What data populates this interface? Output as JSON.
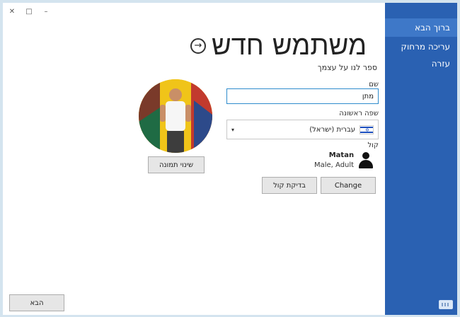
{
  "window_controls": {
    "close": "✕",
    "restore": "□",
    "minimize": "–"
  },
  "sidebar": {
    "items": [
      {
        "label": "ברוך הבא",
        "active": true
      },
      {
        "label": "עריכה מרחוק",
        "active": false
      },
      {
        "label": "עזרה",
        "active": false
      }
    ]
  },
  "header": {
    "title": "משתמש חדש",
    "subtitle": "ספר לנו על עצמך",
    "back_icon": "→"
  },
  "form": {
    "name_label": "שם",
    "name_value": "מתן",
    "language_label": "שפה ראשונה",
    "language_value": "עברית (ישראל)",
    "voice_label": "קול",
    "voice_name": "Matan",
    "voice_desc": "Male, Adult"
  },
  "buttons": {
    "change_picture": "שינוי תמונה",
    "change_voice": "Change",
    "test_voice": "בדיקת קול",
    "next": "הבא"
  },
  "colors": {
    "sidebar": "#2a61b2",
    "accent": "#2e8bcc"
  }
}
